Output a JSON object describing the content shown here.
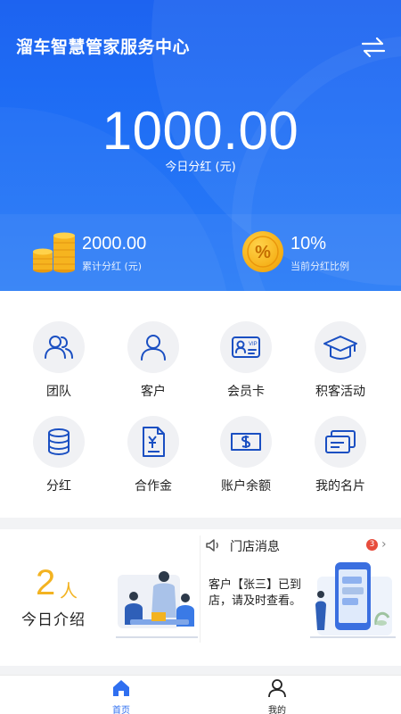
{
  "header": {
    "title": "溜车智慧管家服务中心",
    "swap_icon": "swap-arrows-icon"
  },
  "today": {
    "amount": "1000.00",
    "label": "今日分红 (元)"
  },
  "stats": [
    {
      "value": "2000.00",
      "label": "累计分红 (元)",
      "icon": "coins-icon"
    },
    {
      "value": "10%",
      "label": "当前分红比例",
      "icon": "percent-icon"
    }
  ],
  "grid": [
    {
      "label": "团队",
      "icon": "team-icon"
    },
    {
      "label": "客户",
      "icon": "customer-icon"
    },
    {
      "label": "会员卡",
      "icon": "vip-card-icon"
    },
    {
      "label": "积客活动",
      "icon": "graduation-cap-icon"
    },
    {
      "label": "分红",
      "icon": "coin-stack-icon"
    },
    {
      "label": "合作金",
      "icon": "yuan-document-icon"
    },
    {
      "label": "账户余额",
      "icon": "dollar-bill-icon"
    },
    {
      "label": "我的名片",
      "icon": "business-card-icon"
    }
  ],
  "intro": {
    "count": "2",
    "unit": "人",
    "label": "今日介绍"
  },
  "shop": {
    "title": "门店消息",
    "badge": "3",
    "message": "客户【张三】已到店，请及时查看。"
  },
  "tabs": [
    {
      "label": "首页",
      "icon": "home-icon",
      "active": true
    },
    {
      "label": "我的",
      "icon": "profile-icon",
      "active": false
    }
  ],
  "colors": {
    "primary": "#1f6ef5",
    "accent_gold": "#f3b321",
    "icon_blue": "#1a4fc2"
  }
}
